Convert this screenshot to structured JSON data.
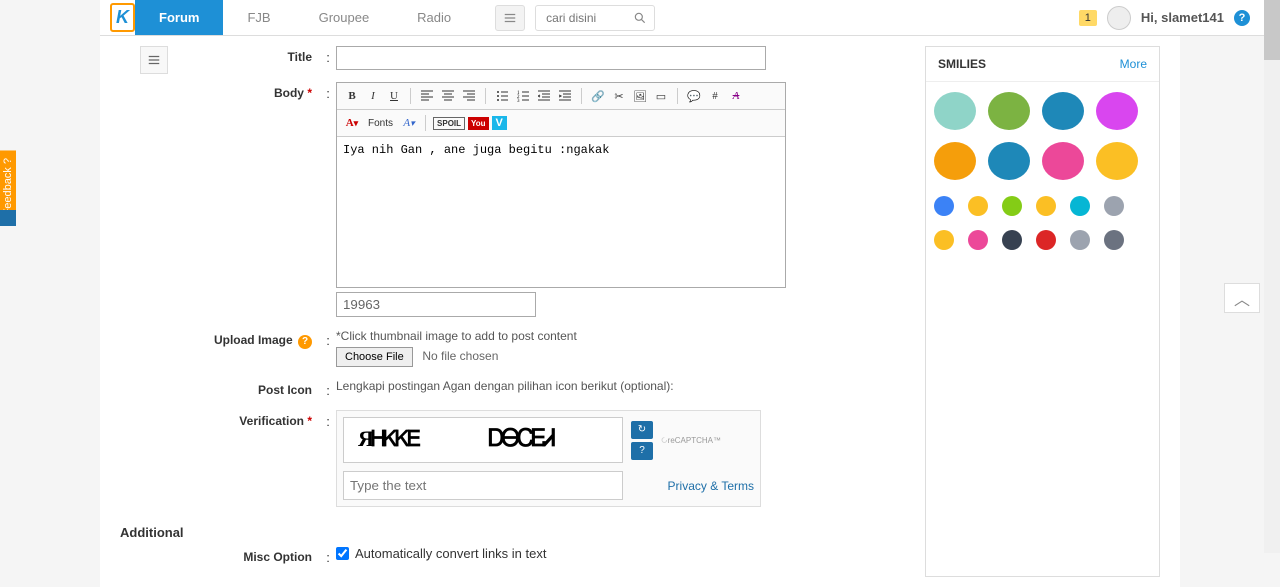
{
  "nav": {
    "items": [
      "Forum",
      "FJB",
      "Groupee",
      "Radio"
    ],
    "active_index": 0
  },
  "search": {
    "placeholder": "cari disini"
  },
  "user": {
    "greeting": "Hi, slamet141",
    "notifications": "1"
  },
  "form": {
    "title_label": "Title",
    "body_label": "Body",
    "body_value": "Iya nih Gan , ane juga begitu :ngakak",
    "counter": "19963",
    "upload_label": "Upload Image",
    "upload_hint": "*Click thumbnail image to add to post content",
    "choose_file": "Choose File",
    "no_file": "No file chosen",
    "posticon_label": "Post Icon",
    "posticon_hint": "Lengkapi postingan Agan dengan pilihan icon berikut (optional):",
    "verification_label": "Verification",
    "captcha_placeholder": "Type the text",
    "captcha_privacy": "Privacy & Terms",
    "recaptcha_text": "reCAPTCHA™",
    "toolbar_fonts": "Fonts",
    "toolbar_spoil": "SPOIL"
  },
  "additional": {
    "header": "Additional",
    "misc_label": "Misc Option",
    "misc_checkbox": "Automatically convert links in text"
  },
  "smilies": {
    "title": "SMILIES",
    "more": "More",
    "colors_big": [
      "#8fd4c8",
      "#7cb342",
      "#1e88b8",
      "#d946ef",
      "#f59e0b",
      "#1e88b8",
      "#ec4899",
      "#fbbf24"
    ],
    "colors_small": [
      "#3b82f6",
      "#fbbf24",
      "#84cc16",
      "#fbbf24",
      "#06b6d4",
      "#9ca3af",
      "#fbbf24",
      "#ec4899",
      "#374151",
      "#dc2626",
      "#9ca3af",
      "#6b7280"
    ]
  },
  "feedback": "Feedback ?"
}
